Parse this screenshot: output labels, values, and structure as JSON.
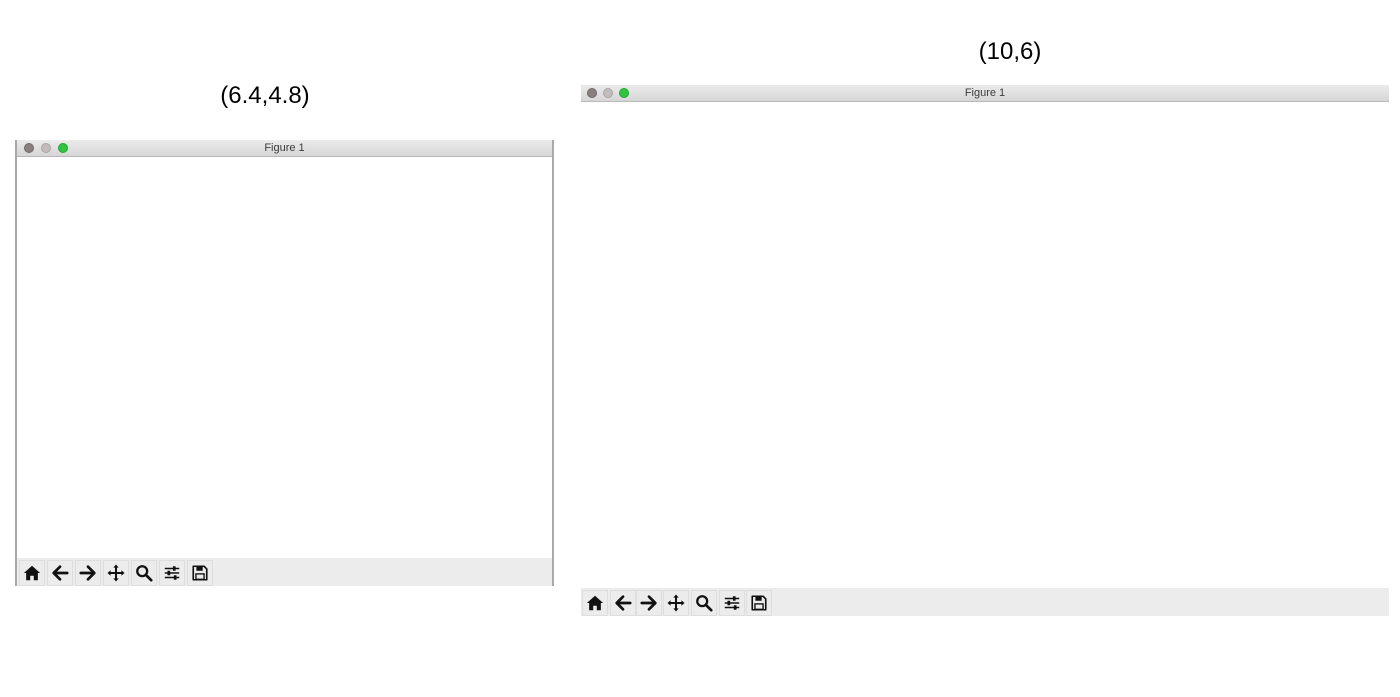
{
  "captions": {
    "left": "(6.4,4.8)",
    "right": "(10,6)"
  },
  "windows": [
    {
      "title": "Figure 1",
      "traffic_lights": {
        "close": "#8a7e7e",
        "minimize": "#c4bcbc",
        "zoom": "#2fc540"
      },
      "toolbar": [
        "home-icon",
        "back-arrow-icon",
        "forward-arrow-icon",
        "pan-icon",
        "zoom-icon",
        "configure-subplots-icon",
        "save-icon"
      ]
    },
    {
      "title": "Figure 1",
      "traffic_lights": {
        "close": "#8a7e7e",
        "minimize": "#c4bcbc",
        "zoom": "#2fc540"
      },
      "toolbar": [
        "home-icon",
        "back-arrow-icon",
        "forward-arrow-icon",
        "pan-icon",
        "zoom-icon",
        "configure-subplots-icon",
        "save-icon"
      ]
    }
  ]
}
